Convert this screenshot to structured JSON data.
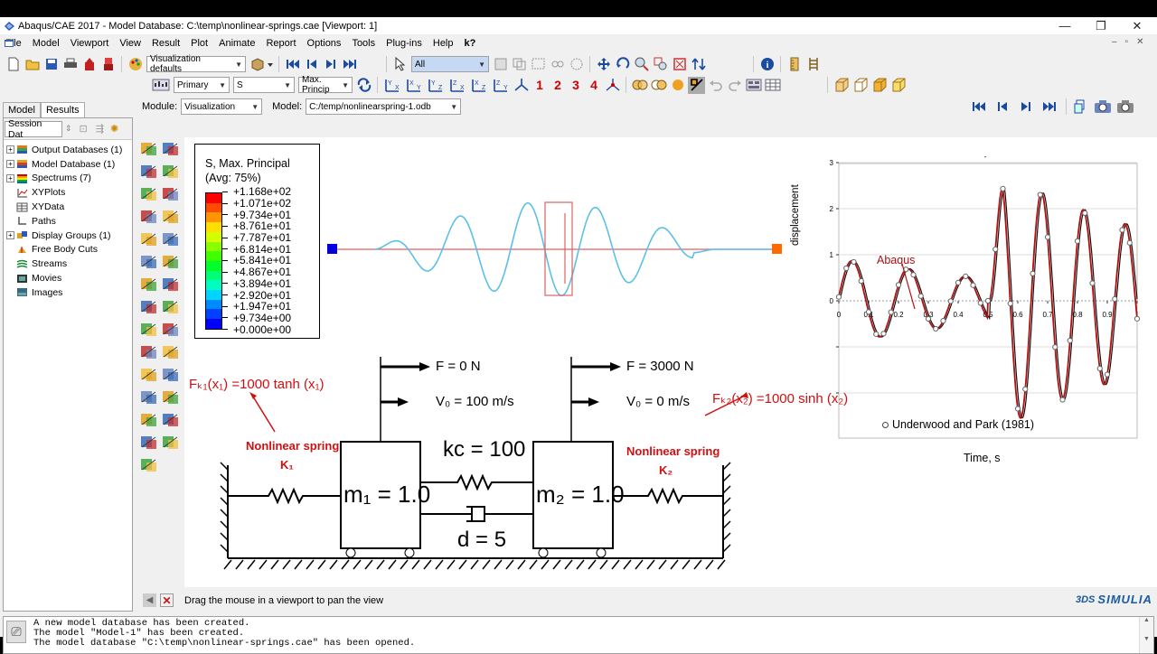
{
  "window": {
    "title": "Abaqus/CAE 2017 - Model Database: C:\\temp\\nonlinear-springs.cae [Viewport: 1]",
    "minimize": "—",
    "restore": "❐",
    "close": "✕"
  },
  "menu": [
    "File",
    "Model",
    "Viewport",
    "View",
    "Result",
    "Plot",
    "Animate",
    "Report",
    "Options",
    "Tools",
    "Plug-ins",
    "Help",
    "k?"
  ],
  "toolbar": {
    "visualization_defaults": "Visualization defaults",
    "selection_filter": "All",
    "primary": "Primary",
    "field": "S",
    "invariant": "Max. Princip",
    "view_numbers": [
      "1",
      "2",
      "3",
      "4"
    ]
  },
  "tabs": [
    "Model",
    "Results"
  ],
  "session_select": "Session Dat",
  "module_label": "Module:",
  "module_value": "Visualization",
  "model_label": "Model:",
  "model_value": "C:/temp/nonlinearspring-1.odb",
  "tree": [
    {
      "label": "Output Databases (1)",
      "expand": "+"
    },
    {
      "label": "Model Database (1)",
      "expand": "+"
    },
    {
      "label": "Spectrums (7)",
      "expand": "+"
    },
    {
      "label": "XYPlots",
      "expand": ""
    },
    {
      "label": "XYData",
      "expand": ""
    },
    {
      "label": "Paths",
      "expand": ""
    },
    {
      "label": "Display Groups (1)",
      "expand": "+"
    },
    {
      "label": "Free Body Cuts",
      "expand": ""
    },
    {
      "label": "Streams",
      "expand": ""
    },
    {
      "label": "Movies",
      "expand": ""
    },
    {
      "label": "Images",
      "expand": ""
    }
  ],
  "legend": {
    "title1": "S, Max. Principal",
    "title2": "(Avg: 75%)",
    "values": [
      "+1.168e+02",
      "+1.071e+02",
      "+9.734e+01",
      "+8.761e+01",
      "+7.787e+01",
      "+6.814e+01",
      "+5.841e+01",
      "+4.867e+01",
      "+3.894e+01",
      "+2.920e+01",
      "+1.947e+01",
      "+9.734e+00",
      "+0.000e+00"
    ],
    "colors": [
      "#ff0000",
      "#ff4a00",
      "#ff9500",
      "#ffdf00",
      "#d4ff00",
      "#8aff00",
      "#40ff00",
      "#00ff2b",
      "#00ff75",
      "#00ffbf",
      "#00d4ff",
      "#008aff",
      "#0040ff",
      "#0000ff"
    ]
  },
  "diagram": {
    "f_left": "F = 0 N",
    "v_left": "V₀ = 100 m/s",
    "f_right": "F = 3000 N",
    "v_right": "V₀ = 0 m/s",
    "fk1": "Fₖ₁(x₁) =1000 tanh (x₁)",
    "fk2": "Fₖ₂(x₂) =1000 sinh (x₂)",
    "spring_left": "Nonlinear spring",
    "spring_left_k": "K₁",
    "spring_right": "Nonlinear spring",
    "spring_right_k": "K₂",
    "m1": "m₁ = 1.0",
    "m2": "m₂ = 1.0",
    "kc": "kc = 100",
    "d": "d = 5"
  },
  "plot": {
    "ylabel": "displacement",
    "xlabel": "Time, s",
    "legend": "Underwood and Park (1981)",
    "abaqus_label": "Abaqus",
    "y_ticks": [
      "3",
      "2",
      "1",
      "0"
    ],
    "x_ticks": [
      "0",
      "0.1",
      "0.2",
      "0.3",
      "0.4",
      "0.5",
      "0.6",
      "0.7",
      "0.8",
      "0.9",
      "1"
    ],
    "marker": "-"
  },
  "prompt": "Drag the mouse in a viewport to pan the view",
  "messages": [
    "A new model database has been created.",
    "The model \"Model-1\" has been created.",
    "The model database \"C:\\temp\\nonlinear-springs.cae\" has been opened."
  ],
  "brand": "SIMULIA",
  "brand_prefix": "3DS"
}
